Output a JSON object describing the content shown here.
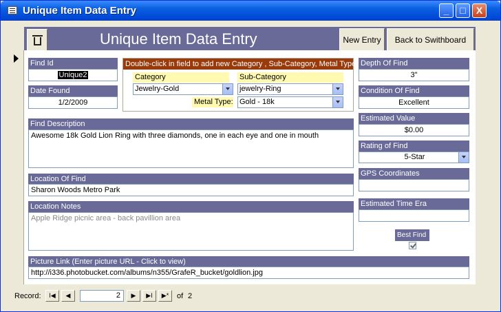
{
  "window": {
    "title": "Unique Item Data Entry",
    "minimize_glyph": "_",
    "maximize_glyph": "□",
    "close_glyph": "X"
  },
  "header": {
    "form_title": "Unique Item Data Entry",
    "new_entry_label": "New Entry",
    "switchboard_label": "Back to Swithboard",
    "delete_icon": "trash-icon"
  },
  "fields": {
    "find_id": {
      "label": "Find Id",
      "value": "Unique2"
    },
    "date_found": {
      "label": "Date Found",
      "value": "1/2/2009"
    },
    "category_group": {
      "caption": "Double-click in field to add new Category , Sub-Category, Metal Type",
      "category_label": "Category",
      "category_value": "Jewelry-Gold",
      "subcategory_label": "Sub-Category",
      "subcategory_value": "jewelry-Ring",
      "metal_label": "Metal Type:",
      "metal_value": "Gold - 18k"
    },
    "find_description": {
      "label": "Find Description",
      "value": "Awesome 18k Gold Lion Ring with three diamonds, one in each eye and one in mouth"
    },
    "location_of_find": {
      "label": "Location Of Find",
      "value": "Sharon Woods Metro Park"
    },
    "location_notes": {
      "label": "Location Notes",
      "value": "Apple Ridge picnic area - back pavillion area"
    },
    "picture_link": {
      "label": "Picture Link (Enter picture URL - Click to view)",
      "value": "http://i336.photobucket.com/albums/n355/GrafeR_bucket/goldlion.jpg"
    },
    "depth_of_find": {
      "label": "Depth Of Find",
      "value": "3\""
    },
    "condition_of_find": {
      "label": "Condition Of Find",
      "value": "Excellent"
    },
    "estimated_value": {
      "label": "Estimated Value",
      "value": "$0.00"
    },
    "rating_of_find": {
      "label": "Rating of Find",
      "value": "5-Star"
    },
    "gps_coordinates": {
      "label": "GPS Coordinates",
      "value": ""
    },
    "estimated_time_era": {
      "label": "Estimated Time Era",
      "value": ""
    },
    "best_find": {
      "label": "Best Find",
      "checked": true
    }
  },
  "navigation": {
    "record_label": "Record:",
    "current_record": "2",
    "of_label": "of",
    "total_records": "2",
    "first_glyph": "I◀",
    "prev_glyph": "◀",
    "next_glyph": "▶",
    "last_glyph": "▶I",
    "new_glyph": "▶*"
  }
}
